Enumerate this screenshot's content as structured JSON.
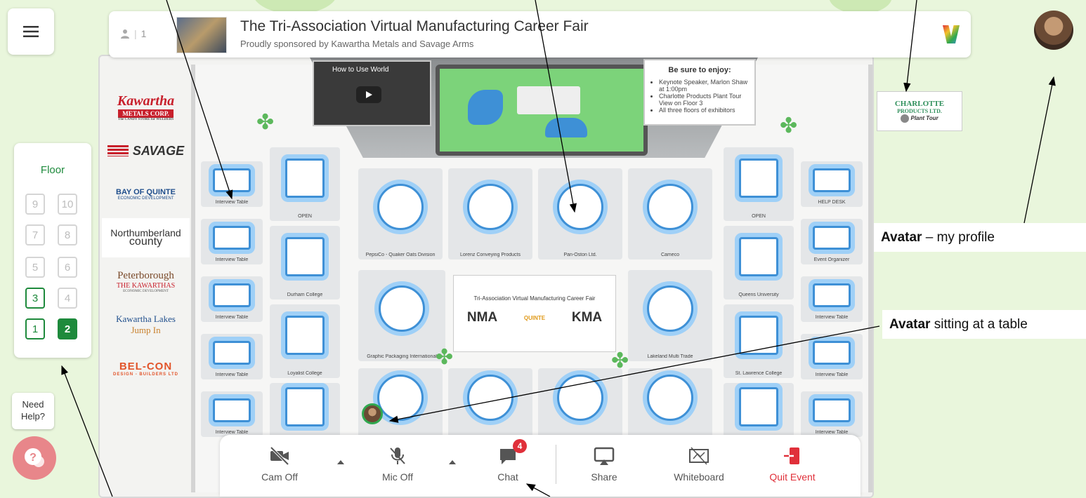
{
  "topbar": {
    "participants_count": "1",
    "title": "The Tri-Association Virtual Manufacturing Career Fair",
    "subtitle": "Proudly sponsored by Kawartha Metals and Savage Arms"
  },
  "notice": {
    "heading": "Be sure to enjoy:",
    "items": [
      "Keynote Speaker, Marlon Shaw at 1:00pm",
      "Charlotte Products Plant Tour View on Floor 3",
      "All three floors of exhibitors"
    ]
  },
  "video": {
    "label": "How to Use World"
  },
  "sponsors": [
    {
      "name": "Kawartha",
      "sub": "METALS CORP.",
      "tag": "The CANDY STORE for WELDERS",
      "color": "#c8202c"
    },
    {
      "name": "SAVAGE",
      "color": "#1a1a1a"
    },
    {
      "name": "BAY OF QUINTE",
      "sub": "ECONOMIC DEVELOPMENT",
      "color": "#1f4e8c"
    },
    {
      "name": "Northumberland",
      "sub": "county",
      "color": "#333333"
    },
    {
      "name": "Peterborough",
      "sub": "THE KAWARTHAS",
      "tag": "ECONOMIC DEVELOPMENT",
      "color": "#7a4a2a"
    },
    {
      "name": "Kawartha Lakes",
      "sub": "Jump In",
      "color": "#1f4e8c"
    },
    {
      "name": "BEL-CON",
      "sub": "DESIGN - BUILDERS LTD",
      "color": "#e2542a"
    }
  ],
  "charlotte": {
    "name": "CHARLOTTE",
    "sub": "PRODUCTS LTD.",
    "link": "Plant Tour"
  },
  "booths": {
    "left_rect": [
      "Interview Table",
      "Interview Table",
      "Interview Table",
      "Interview Table",
      "Interview Table"
    ],
    "left_sq": [
      "OPEN",
      "Durham College",
      "Loyalist College"
    ],
    "round_row1": [
      "PepsiCo - Quaker Oats Division",
      "Lorenz Conveying Products",
      "Pan-Oston Ltd.",
      "Cameco"
    ],
    "round_mid_left": "Graphic Packaging International",
    "round_mid_right": "Lakeland Multi Trade",
    "right_sq": [
      "OPEN",
      "Queens University",
      "St. Lawrence College"
    ],
    "right_rect": [
      "HELP DESK",
      "Event Organizer",
      "Interview Table",
      "Interview Table",
      "Interview Table"
    ]
  },
  "banner": {
    "title": "Tri-Association Virtual Manufacturing Career Fair",
    "logo1": "NMA",
    "logo2": "QUINTE",
    "logo3": "KMA"
  },
  "floor_panel": {
    "label": "Floor",
    "floors": [
      "9",
      "10",
      "7",
      "8",
      "5",
      "6",
      "3",
      "4",
      "1",
      "2"
    ],
    "current": "2"
  },
  "help": {
    "label": "Need Help?"
  },
  "toolbar": {
    "cam": "Cam Off",
    "mic": "Mic Off",
    "chat": "Chat",
    "chat_badge": "4",
    "share": "Share",
    "whiteboard": "Whiteboard",
    "quit": "Quit Event"
  },
  "callouts": {
    "profile_bold": "Avatar",
    "profile_rest": " – my profile",
    "sitting_bold": "Avatar",
    "sitting_rest": " sitting at a table"
  },
  "colors": {
    "accent_green": "#1e8a3c",
    "quit_red": "#e0303a",
    "table_blue": "#3e90d6"
  }
}
